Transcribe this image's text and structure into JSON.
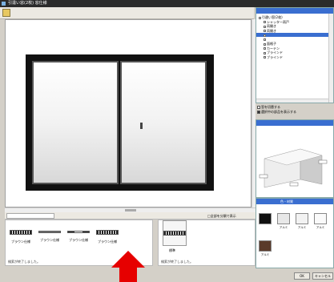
{
  "window": {
    "title": "引違い窓(2枚) 窓仕様"
  },
  "bottom_tabs": {
    "tab_label": "",
    "option_label": "□全部を分類で表示"
  },
  "thumbnails": {
    "items": [
      {
        "label": "ブラウン仕様"
      },
      {
        "label": "ブラウン仕様"
      },
      {
        "label": "ブラウン仕様"
      },
      {
        "label": "ブラウン仕様"
      }
    ],
    "message": "検索が終了しました。",
    "selected_label": "標準",
    "selected_message": "検索が終了しました。"
  },
  "tree": {
    "header": "",
    "nodes": [
      {
        "label": "引違い窓(2枚)",
        "selected": false,
        "indent": 0
      },
      {
        "label": "シャッター雨戸",
        "selected": false,
        "indent": 2
      },
      {
        "label": "両開き",
        "selected": false,
        "indent": 2
      },
      {
        "label": "両開き",
        "selected": false,
        "indent": 2
      },
      {
        "label": "",
        "selected": true,
        "indent": 2
      },
      {
        "label": "",
        "selected": false,
        "indent": 2
      },
      {
        "label": "面格子",
        "selected": false,
        "indent": 2
      },
      {
        "label": "カーテン",
        "selected": false,
        "indent": 2
      },
      {
        "label": "ブラインド",
        "selected": false,
        "indent": 2
      },
      {
        "label": "ブラインド",
        "selected": false,
        "indent": 2
      }
    ]
  },
  "options": [
    {
      "label": "窓を切替する",
      "checked": false
    },
    {
      "label": "選択中の部品を表示する",
      "checked": true
    }
  ],
  "scene": {
    "header": ""
  },
  "colors": {
    "header": "色・材質",
    "swatches": [
      {
        "color": "#111111",
        "label": ""
      },
      {
        "color": "#e8e8e8",
        "label": "アルミ"
      },
      {
        "color": "#f2f2f2",
        "label": "アルミ"
      },
      {
        "color": "#fafafa",
        "label": "アルミ"
      },
      {
        "color": "#5a3a2a",
        "label": "アルミ"
      }
    ]
  },
  "buttons": {
    "ok": "OK",
    "cancel": "キャンセル"
  },
  "accent": {
    "arrow": "#e60000",
    "selection": "#3a6ed0"
  }
}
